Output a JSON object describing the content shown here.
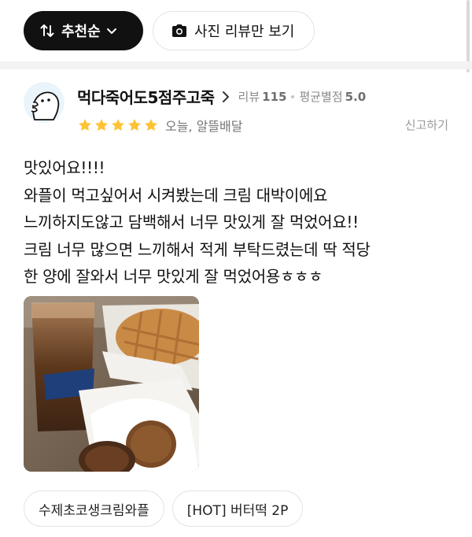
{
  "filters": {
    "sort_label": "추천순",
    "photo_only_label": "사진 리뷰만 보기"
  },
  "review": {
    "username": "먹다죽어도5점주고죽",
    "review_count_label": "리뷰",
    "review_count": "115",
    "avg_rating_label": "평균별점",
    "avg_rating": "5.0",
    "stars": 5,
    "date_delivery": "오늘, 알뜰배달",
    "report_label": "신고하기",
    "text_lines": [
      "맛있어요!!!!",
      "와플이 먹고싶어서 시켜봤는데 크림 대박이에요",
      "느끼하지도않고 담백해서 너무 맛있게 잘 먹었어요!!",
      "크림 너무 많으면 느끼해서 적게 부탁드렸는데 딱 적당",
      "한 양에 잘와서 너무 맛있게 잘 먹었어용ㅎㅎㅎ"
    ],
    "menu_items": [
      "수제초코생크림와플",
      "[HOT] 버터떡 2P"
    ]
  },
  "colors": {
    "star": "#FFC234",
    "dark_pill": "#111111",
    "muted_text": "#8a8a8a"
  },
  "icons": {
    "sort": "sort-arrows-icon",
    "chevron": "chevron-down-icon",
    "camera": "camera-icon",
    "profile_chevron": "chevron-right-icon",
    "star": "star-icon"
  }
}
